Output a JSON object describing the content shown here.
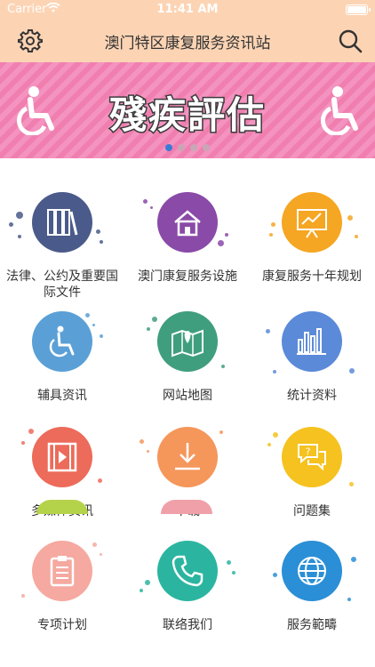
{
  "status_bar": {
    "carrier": "Carrier",
    "time": "11:41 AM"
  },
  "header": {
    "title": "澳门特区康复服务资讯站"
  },
  "banner": {
    "text": "殘疾評估",
    "slides": 4,
    "active_slide": 1
  },
  "grid": [
    {
      "label": "法律、公约及重要国际文件",
      "icon": "books-icon",
      "color": "#4a5a8a"
    },
    {
      "label": "澳门康复服务设施",
      "icon": "home-icon",
      "color": "#8a4aa8"
    },
    {
      "label": "康复服务十年规划",
      "icon": "presentation-chart-icon",
      "color": "#f5a623"
    },
    {
      "label": "辅具资讯",
      "icon": "wheelchair-icon",
      "color": "#5aa0d6"
    },
    {
      "label": "网站地图",
      "icon": "map-icon",
      "color": "#3f9e7e"
    },
    {
      "label": "统计资料",
      "icon": "bar-chart-icon",
      "color": "#5b8ad8"
    },
    {
      "label": "多媒体资讯",
      "icon": "film-icon",
      "color": "#ec6b5a"
    },
    {
      "label": "下载",
      "icon": "download-icon",
      "color": "#f5965b"
    },
    {
      "label": "问题集",
      "icon": "chat-question-icon",
      "color": "#f5c21f"
    },
    {
      "label": "专项计划",
      "icon": "clipboard-icon",
      "color": "#f5a9a0"
    },
    {
      "label": "联络我们",
      "icon": "phone-icon",
      "color": "#2bb5a0"
    },
    {
      "label": "服务範疇",
      "icon": "globe-icon",
      "color": "#2a8fd6"
    }
  ]
}
